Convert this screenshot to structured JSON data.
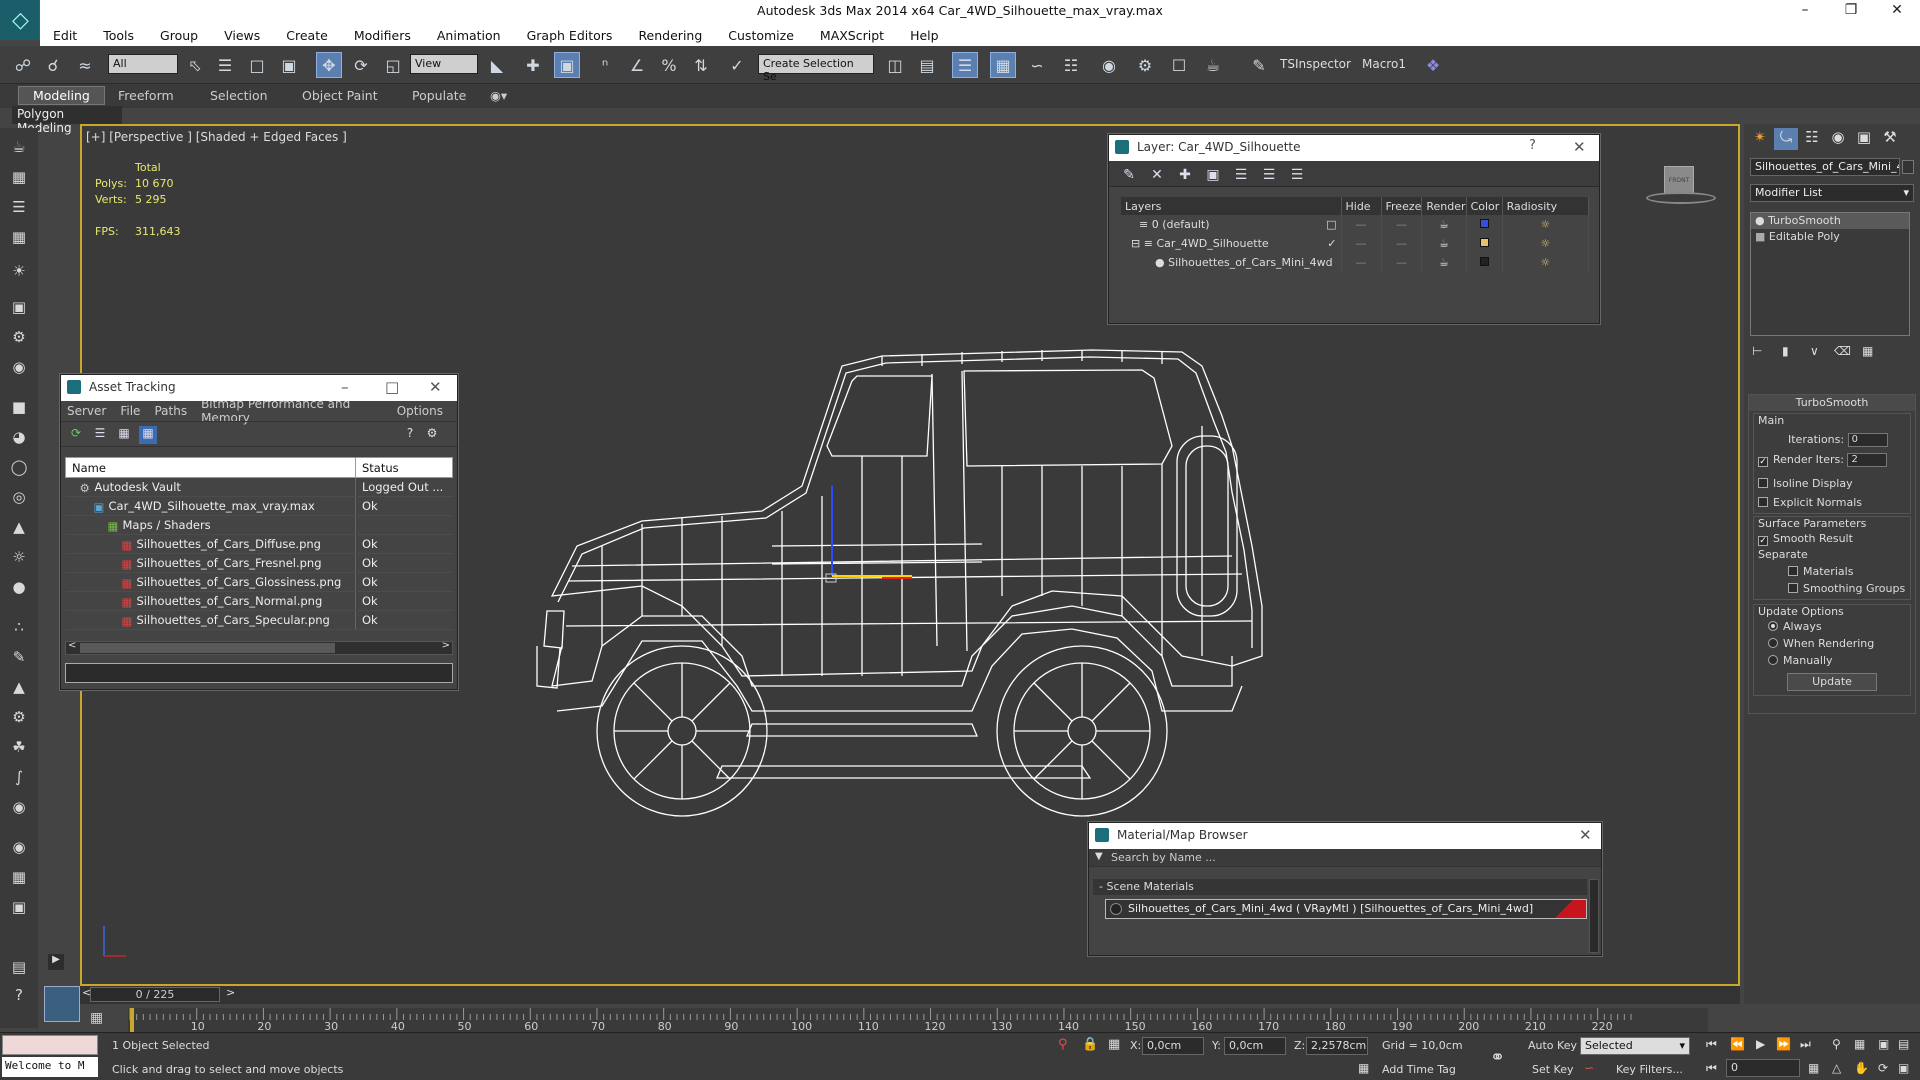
{
  "window": {
    "title": "Autodesk 3ds Max  2014 x64     Car_4WD_Silhouette_max_vray.max"
  },
  "menu": [
    "Edit",
    "Tools",
    "Group",
    "Views",
    "Create",
    "Modifiers",
    "Animation",
    "Graph Editors",
    "Rendering",
    "Customize",
    "MAXScript",
    "Help"
  ],
  "toolbar": {
    "filter": "All",
    "refcoord": "View",
    "selset": "Create Selection Se",
    "tsinspector": "TSInspector",
    "macro": "Macro1"
  },
  "ribbon": {
    "tabs": [
      "Modeling",
      "Freeform",
      "Selection",
      "Object Paint",
      "Populate"
    ],
    "sub": "Polygon Modeling"
  },
  "viewport": {
    "label": "[+] [Perspective ] [Shaded + Edged Faces ]",
    "stats": {
      "total_label": "Total",
      "polys_label": "Polys:",
      "polys": "10 670",
      "verts_label": "Verts:",
      "verts": "5 295",
      "fps_label": "FPS:",
      "fps": "311,643"
    },
    "viewcube": "FRONT"
  },
  "layer_dialog": {
    "title": "Layer: Car_4WD_Silhouette",
    "help": "?",
    "headers": [
      "Layers",
      "Hide",
      "Freeze",
      "Render",
      "Color",
      "Radiosity"
    ],
    "rows": [
      {
        "name": "0 (default)",
        "color": "#3a4fd0"
      },
      {
        "name": "Car_4WD_Silhouette",
        "color": "#e6c46a"
      },
      {
        "name": "Silhouettes_of_Cars_Mini_4wd",
        "color": "#222222"
      }
    ]
  },
  "asset_dialog": {
    "title": "Asset Tracking",
    "menu": [
      "Server",
      "File",
      "Paths",
      "Bitmap Performance and Memory",
      "Options"
    ],
    "headers": [
      "Name",
      "Status"
    ],
    "rows": [
      {
        "name": "Autodesk Vault",
        "status": "Logged Out ...",
        "indent": 1
      },
      {
        "name": "Car_4WD_Silhouette_max_vray.max",
        "status": "Ok",
        "indent": 2
      },
      {
        "name": "Maps / Shaders",
        "status": "",
        "indent": 3
      },
      {
        "name": "Silhouettes_of_Cars_Diffuse.png",
        "status": "Ok",
        "indent": 4
      },
      {
        "name": "Silhouettes_of_Cars_Fresnel.png",
        "status": "Ok",
        "indent": 4
      },
      {
        "name": "Silhouettes_of_Cars_Glossiness.png",
        "status": "Ok",
        "indent": 4
      },
      {
        "name": "Silhouettes_of_Cars_Normal.png",
        "status": "Ok",
        "indent": 4
      },
      {
        "name": "Silhouettes_of_Cars_Specular.png",
        "status": "Ok",
        "indent": 4
      }
    ]
  },
  "material_browser": {
    "title": "Material/Map Browser",
    "search_placeholder": "Search by Name ...",
    "section": "- Scene Materials",
    "item": "Silhouettes_of_Cars_Mini_4wd  ( VRayMtl ) [Silhouettes_of_Cars_Mini_4wd]"
  },
  "command_panel": {
    "object_name": "Silhouettes_of_Cars_Mini_4w",
    "modifier_list": "Modifier List",
    "stack": [
      "TurboSmooth",
      "Editable Poly"
    ],
    "turbosmooth": {
      "title": "TurboSmooth",
      "main": "Main",
      "iterations_label": "Iterations:",
      "iterations": "0",
      "render_iters_label": "Render Iters:",
      "render_iters": "2",
      "isoline": "Isoline Display",
      "explicit": "Explicit Normals",
      "surface": "Surface Parameters",
      "smooth_result": "Smooth Result",
      "separate": "Separate",
      "materials": "Materials",
      "smoothing_groups": "Smoothing Groups",
      "update_options": "Update Options",
      "always": "Always",
      "when_rendering": "When Rendering",
      "manually": "Manually",
      "update": "Update"
    }
  },
  "timeline": {
    "frame": "0 / 225",
    "ticks": [
      "0",
      "10",
      "20",
      "30",
      "40",
      "50",
      "60",
      "70",
      "80",
      "90",
      "100",
      "110",
      "120",
      "130",
      "140",
      "150",
      "160",
      "170",
      "180",
      "190",
      "200",
      "210",
      "220"
    ]
  },
  "status": {
    "maxscript": "Welcome to M",
    "selected": "1 Object Selected",
    "prompt": "Click and drag to select and move objects",
    "x_label": "X:",
    "x": "0,0cm",
    "y_label": "Y:",
    "y": "0,0cm",
    "z_label": "Z:",
    "z": "2,2578cm",
    "grid": "Grid = 10,0cm",
    "autokey": "Auto Key",
    "setkey": "Set Key",
    "sel_mode": "Selected",
    "keyfilters": "Key Filters...",
    "addtimetag": "Add Time Tag",
    "frame": "0"
  }
}
